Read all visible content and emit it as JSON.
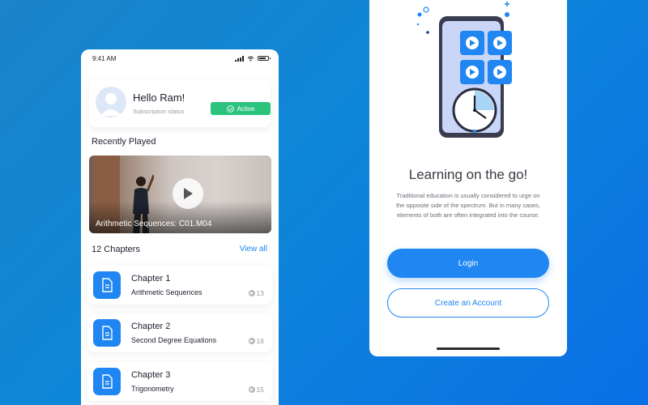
{
  "colors": {
    "accent": "#1f86f2",
    "active": "#2cc47d",
    "text_dark": "#1e1e2e",
    "text_muted": "#9a9aa6"
  },
  "left_screen": {
    "status_bar": {
      "time": "9:41 AM",
      "icons": [
        "signal-icon",
        "wifi-icon",
        "battery-icon"
      ]
    },
    "profile": {
      "greeting": "Hello Ram!",
      "subscription_label": "Subscription status",
      "status_badge": "Active",
      "status_icon": "check-circle-icon"
    },
    "recently_played": {
      "title": "Recently Played",
      "video_title": "Arithmetic Sequences: C01.M04",
      "play_icon": "play-icon"
    },
    "chapters": {
      "title": "12 Chapters",
      "view_all": "View all",
      "items": [
        {
          "title": "Chapter 1",
          "subtitle": "Arithmetic Sequences",
          "count": "13",
          "icon": "document-icon"
        },
        {
          "title": "Chapter 2",
          "subtitle": "Second Degree Equations",
          "count": "16",
          "icon": "document-icon"
        },
        {
          "title": "Chapter 3",
          "subtitle": "Trigonometry",
          "count": "15",
          "icon": "document-icon"
        }
      ]
    }
  },
  "right_screen": {
    "illustration": "phone-videos-clock-illustration",
    "headline": "Learning on the go!",
    "body": "Traditional education is usually considered to urge on the opposite side of the spectrum. But in many cases, elements of both are often integrated into the course.",
    "login_button": "Login",
    "create_account_button": "Create an Account"
  }
}
